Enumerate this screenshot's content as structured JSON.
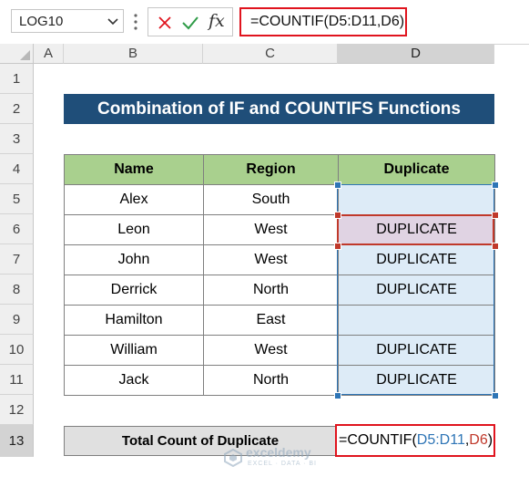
{
  "formula_bar": {
    "name_box": "LOG10",
    "formula": "=COUNTIF(D5:D11,D6)",
    "fx_label": "fx"
  },
  "columns": [
    "A",
    "B",
    "C",
    "D"
  ],
  "rows": [
    "1",
    "2",
    "3",
    "4",
    "5",
    "6",
    "7",
    "8",
    "9",
    "10",
    "11",
    "12",
    "13"
  ],
  "title": "Combination of IF and COUNTIFS Functions",
  "table": {
    "headers": [
      "Name",
      "Region",
      "Duplicate"
    ],
    "rows": [
      {
        "name": "Alex",
        "region": "South",
        "dup": ""
      },
      {
        "name": "Leon",
        "region": "West",
        "dup": "DUPLICATE"
      },
      {
        "name": "John",
        "region": "West",
        "dup": "DUPLICATE"
      },
      {
        "name": "Derrick",
        "region": "North",
        "dup": "DUPLICATE"
      },
      {
        "name": "Hamilton",
        "region": "East",
        "dup": ""
      },
      {
        "name": "William",
        "region": "West",
        "dup": "DUPLICATE"
      },
      {
        "name": "Jack",
        "region": "North",
        "dup": "DUPLICATE"
      }
    ]
  },
  "total": {
    "label": "Total Count of Duplicate",
    "formula_prefix": "=COUNTIF(",
    "range_ref": "D5:D11",
    "comma": ",",
    "cell_ref": "D6",
    "suffix": ")"
  },
  "watermark": {
    "name": "exceldemy",
    "tagline": "EXCEL · DATA · BI"
  },
  "colors": {
    "title_bg": "#1f4e79",
    "header_bg": "#a9d08e",
    "dup_bg": "#ddebf7",
    "highlight": "#e0141e"
  }
}
